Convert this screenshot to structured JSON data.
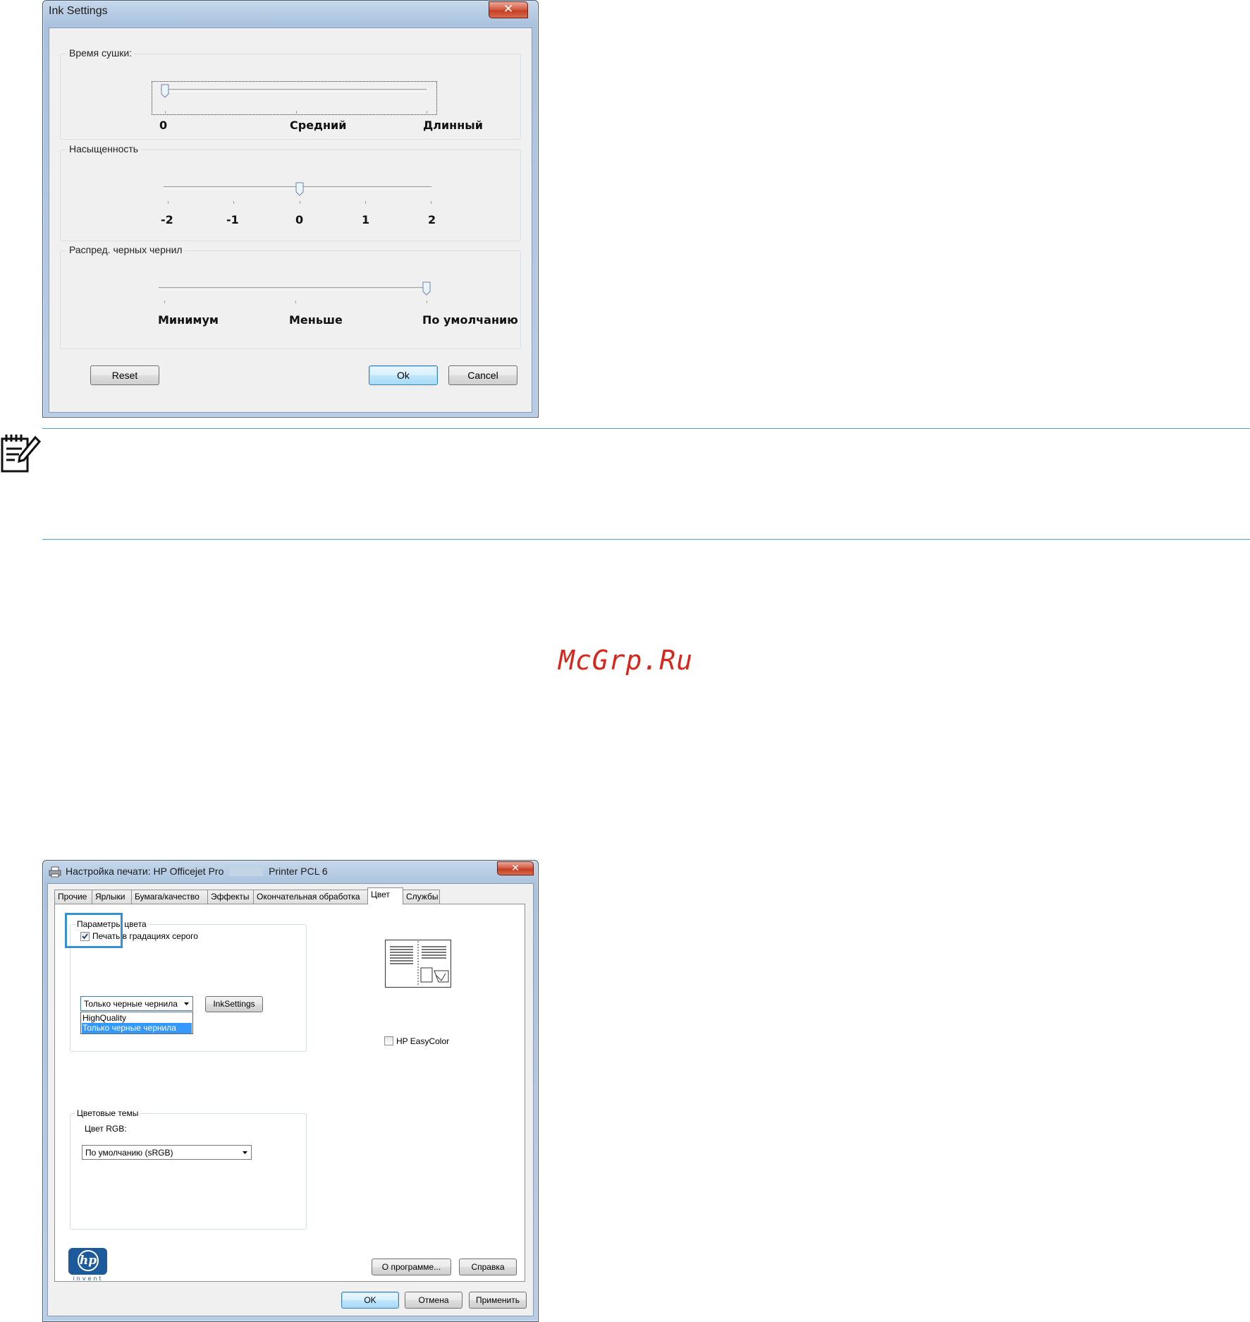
{
  "ink_dialog": {
    "title": "Ink Settings",
    "close_glyph": "✕",
    "drying_time": {
      "label": "Время сушки:",
      "labels": [
        "0",
        "Средний",
        "Длинный"
      ],
      "position": 0
    },
    "saturation": {
      "label": "Насыщенность",
      "labels": [
        "-2",
        "-1",
        "0",
        "1",
        "2"
      ],
      "value": 0
    },
    "black_ink_spread": {
      "label": "Распред. черных чернил",
      "labels": [
        "Минимум",
        "Меньше",
        "По умолчанию"
      ],
      "position": "По умолчанию"
    },
    "buttons": {
      "reset": "Reset",
      "ok": "Ok",
      "cancel": "Cancel"
    }
  },
  "note": {
    "icon": "note-icon",
    "accent_color": "#4f9fd3"
  },
  "watermark": {
    "text": "McGrp.Ru",
    "color": "#d9261c"
  },
  "print_dialog": {
    "title_prefix": "Настройка печати: HP Officejet Pro",
    "title_suffix": "Printer PCL 6",
    "close_glyph": "✕",
    "tabs": [
      "Прочие",
      "Ярлыки",
      "Бумага/качество",
      "Эффекты",
      "Окончательная обработка",
      "Цвет",
      "Службы"
    ],
    "active_tab": "Цвет",
    "color_options": {
      "label": "Параметры цвета",
      "grayscale_checkbox": "Печать в градациях серого",
      "grayscale_checked": true,
      "combo_value": "Только черные чернила",
      "ink_settings_button": "InkSettings",
      "dropdown_options": [
        "HighQuality",
        "Только черные чернила"
      ],
      "dropdown_selected": "Только черные чернила"
    },
    "easycolor": {
      "label": "HP EasyColor",
      "checked": false
    },
    "color_themes": {
      "label": "Цветовые темы",
      "rgb_label": "Цвет RGB:",
      "rgb_value": "По умолчанию (sRGB)"
    },
    "logo": {
      "brand": "hp",
      "tagline": "invent"
    },
    "buttons": {
      "about": "О программе...",
      "help": "Справка",
      "ok": "OK",
      "cancel": "Отмена",
      "apply": "Применить"
    },
    "highlight_color": "#3591d1"
  }
}
